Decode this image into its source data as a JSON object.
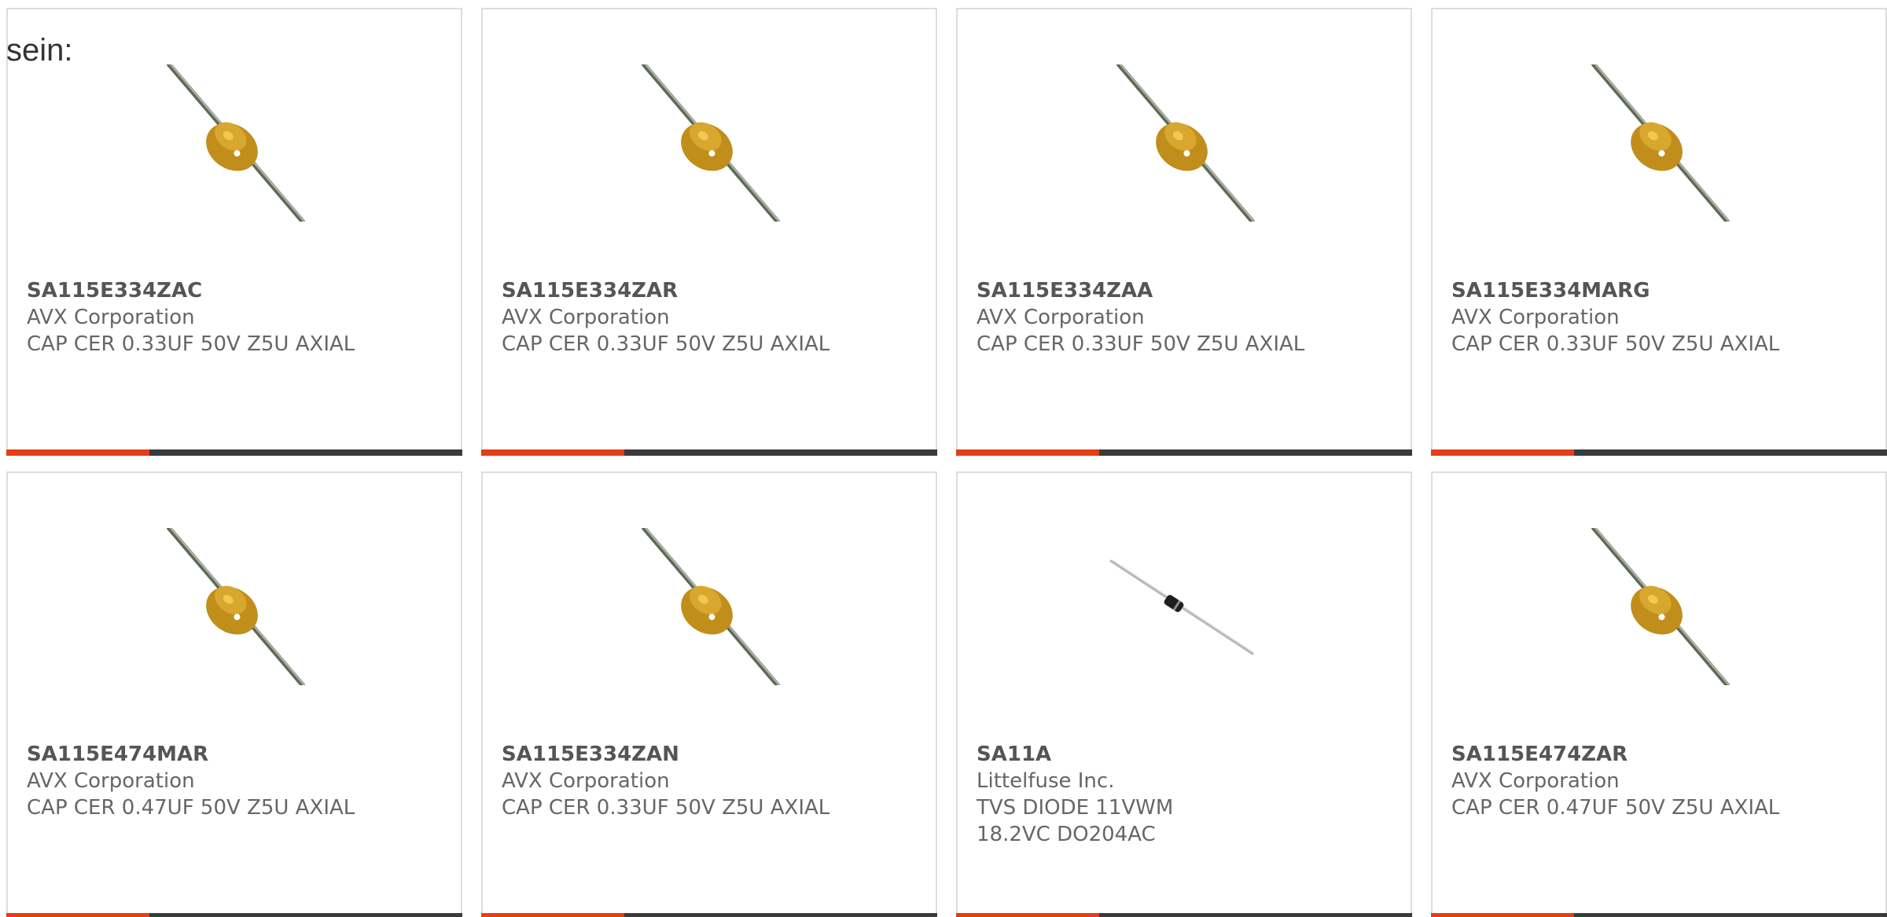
{
  "lead_text": "sein:",
  "colors": {
    "card_border": "#dddddd",
    "text": "#666666",
    "part_number": "#555555",
    "accent": "#e43e16",
    "bar": "#3b3b3b"
  },
  "products": [
    {
      "part_number": "SA115E334ZAC",
      "manufacturer": "AVX Corporation",
      "description": "CAP CER 0.33UF 50V Z5U AXIAL",
      "image": "ceramic-capacitor-image"
    },
    {
      "part_number": "SA115E334ZAR",
      "manufacturer": "AVX Corporation",
      "description": "CAP CER 0.33UF 50V Z5U AXIAL",
      "image": "ceramic-capacitor-image"
    },
    {
      "part_number": "SA115E334ZAA",
      "manufacturer": "AVX Corporation",
      "description": "CAP CER 0.33UF 50V Z5U AXIAL",
      "image": "ceramic-capacitor-image"
    },
    {
      "part_number": "SA115E334MARG",
      "manufacturer": "AVX Corporation",
      "description": "CAP CER 0.33UF 50V Z5U AXIAL",
      "image": "ceramic-capacitor-image"
    },
    {
      "part_number": "SA115E474MAR",
      "manufacturer": "AVX Corporation",
      "description": "CAP CER 0.47UF 50V Z5U AXIAL",
      "image": "ceramic-capacitor-image"
    },
    {
      "part_number": "SA115E334ZAN",
      "manufacturer": "AVX Corporation",
      "description": "CAP CER 0.33UF 50V Z5U AXIAL",
      "image": "ceramic-capacitor-image"
    },
    {
      "part_number": "SA11A",
      "manufacturer": "Littelfuse Inc.",
      "description": "TVS DIODE 11VWM 18.2VC DO204AC",
      "image": "axial-diode-image"
    },
    {
      "part_number": "SA115E474ZAR",
      "manufacturer": "AVX Corporation",
      "description": "CAP CER 0.47UF 50V Z5U AXIAL",
      "image": "ceramic-capacitor-image"
    }
  ]
}
